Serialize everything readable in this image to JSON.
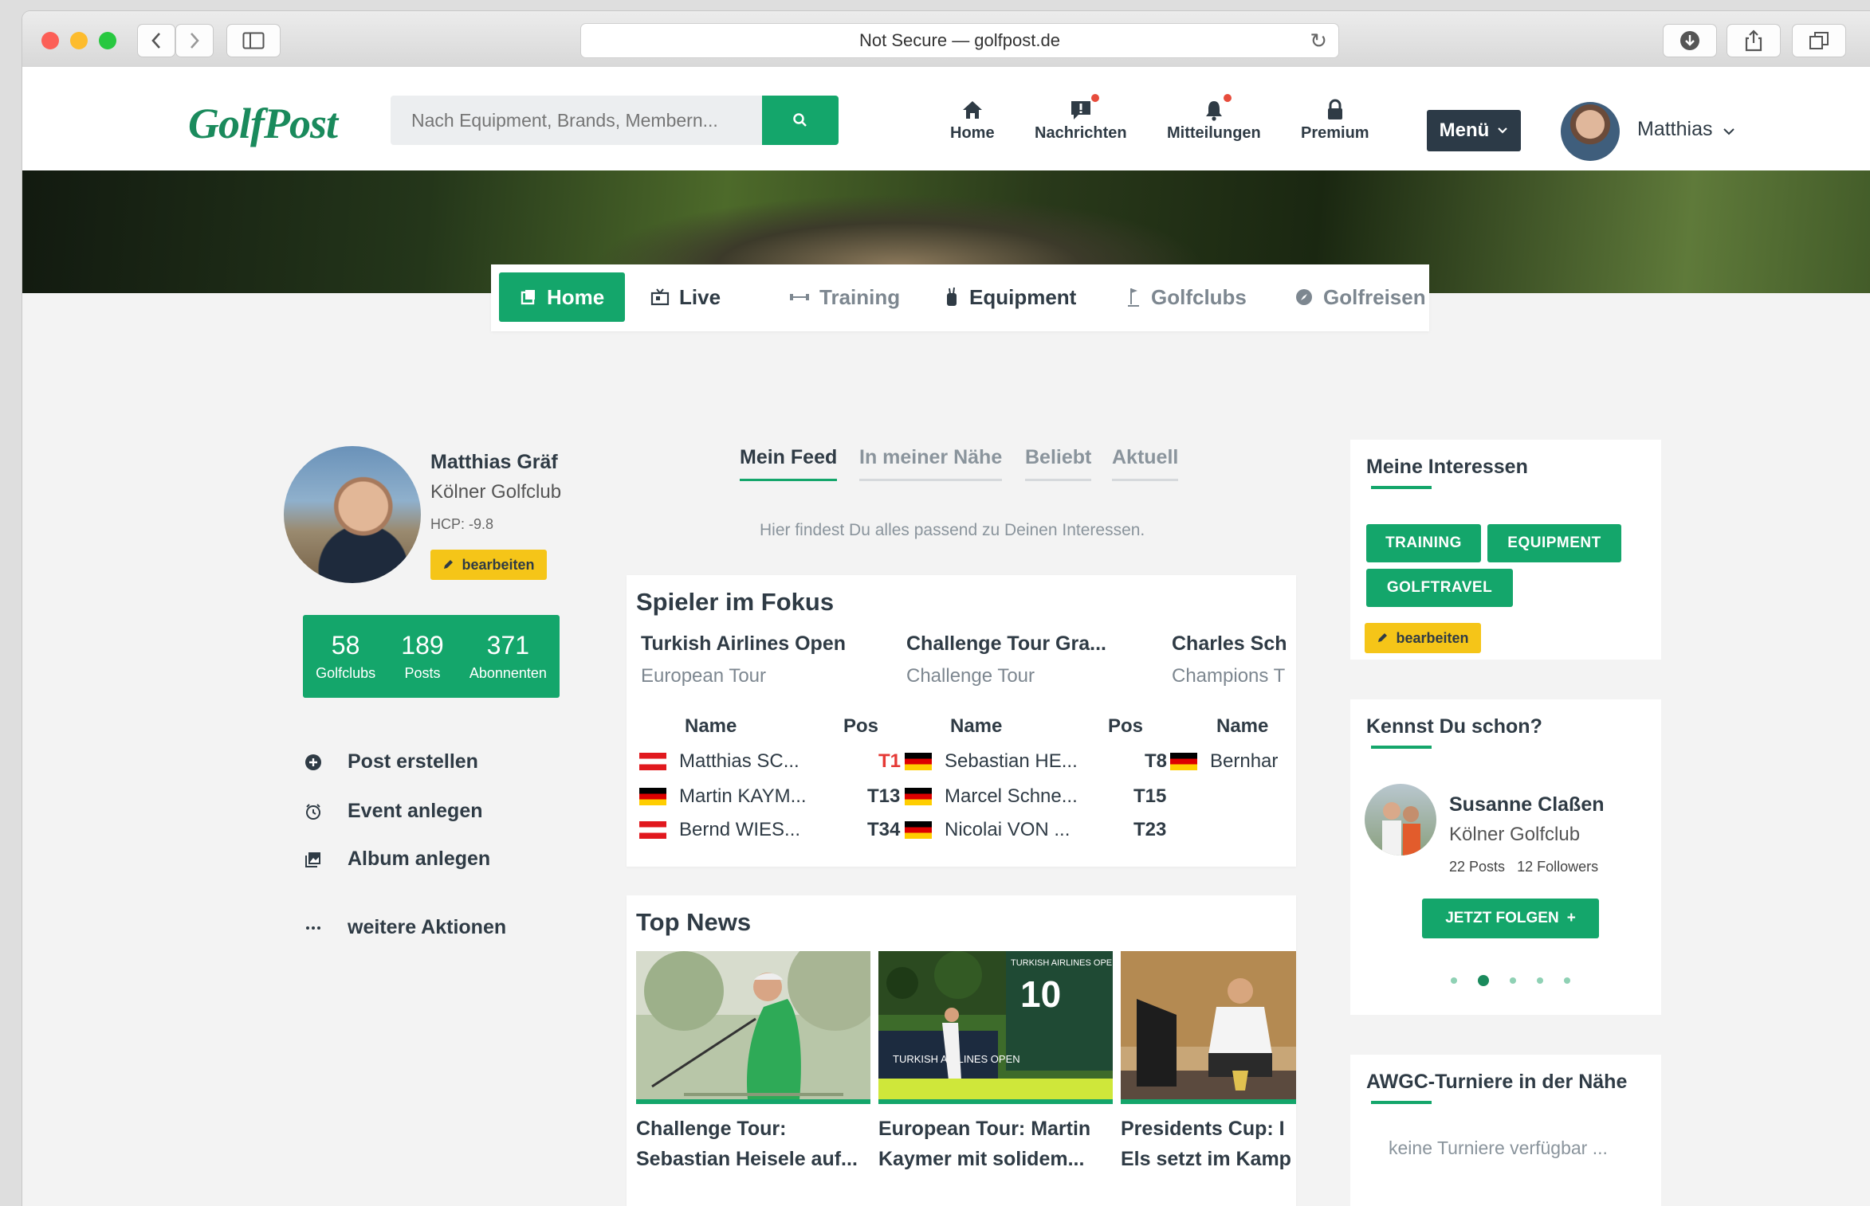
{
  "browser": {
    "address": "Not Secure — golfpost.de"
  },
  "header": {
    "logo": "GolfPost",
    "search_placeholder": "Nach Equipment, Brands, Membern...",
    "nav": [
      {
        "label": "Home",
        "icon": "home-icon"
      },
      {
        "label": "Nachrichten",
        "icon": "message-icon"
      },
      {
        "label": "Mitteilungen",
        "icon": "bell-icon"
      },
      {
        "label": "Premium",
        "icon": "lock-icon"
      }
    ],
    "menu_label": "Menü",
    "user_name": "Matthias"
  },
  "subnav": [
    "Home",
    "Live",
    "Training",
    "Equipment",
    "Golfclubs",
    "Golfreisen"
  ],
  "profile": {
    "name": "Matthias Gräf",
    "club": "Kölner Golfclub",
    "hcp": "HCP: -9.8",
    "edit_label": "bearbeiten",
    "stats": [
      {
        "value": "58",
        "label": "Golfclubs"
      },
      {
        "value": "189",
        "label": "Posts"
      },
      {
        "value": "371",
        "label": "Abonnenten"
      }
    ],
    "actions": [
      {
        "label": "Post erstellen",
        "icon": "plus-circle-icon"
      },
      {
        "label": "Event anlegen",
        "icon": "alarm-clock-icon"
      },
      {
        "label": "Album anlegen",
        "icon": "album-icon"
      },
      {
        "label": "weitere Aktionen",
        "icon": "more-icon"
      }
    ]
  },
  "feed": {
    "tabs": [
      "Mein Feed",
      "In meiner Nähe",
      "Beliebt",
      "Aktuell"
    ],
    "hint": "Hier findest Du alles passend zu Deinen Interessen."
  },
  "spieler": {
    "title": "Spieler im Fokus",
    "col_name": "Name",
    "col_pos": "Pos",
    "tournaments": [
      {
        "name": "Turkish Airlines Open",
        "tour": "European Tour",
        "players": [
          {
            "name": "Matthias SC...",
            "pos": "T1",
            "flag": "at"
          },
          {
            "name": "Martin KAYM...",
            "pos": "T13",
            "flag": "de"
          },
          {
            "name": "Bernd WIES...",
            "pos": "T34",
            "flag": "at"
          }
        ]
      },
      {
        "name": "Challenge Tour Gra...",
        "tour": "Challenge Tour",
        "players": [
          {
            "name": "Sebastian HE...",
            "pos": "T8",
            "flag": "de"
          },
          {
            "name": "Marcel Schne...",
            "pos": "T15",
            "flag": "de"
          },
          {
            "name": "Nicolai VON ...",
            "pos": "T23",
            "flag": "de"
          }
        ]
      },
      {
        "name": "Charles Sch",
        "tour": "Champions T",
        "players": [
          {
            "name": "Bernhar",
            "pos": "",
            "flag": "de"
          }
        ]
      }
    ]
  },
  "news": {
    "title": "Top News",
    "items": [
      {
        "line1": "Challenge Tour:",
        "line2": "Sebastian Heisele auf..."
      },
      {
        "line1": "European Tour: Martin",
        "line2": "Kaymer mit solidem..."
      },
      {
        "line1": "Presidents Cup: I",
        "line2": "Els setzt im Kamp"
      }
    ],
    "image_texts": {
      "sign_number": "10",
      "sign_top": "TURKISH AIRLINES OPEN",
      "banner": "TURKISH AIRLINES OPEN"
    }
  },
  "interessen": {
    "title": "Meine Interessen",
    "tags": [
      "TRAINING",
      "EQUIPMENT",
      "GOLFTRAVEL"
    ],
    "edit_label": "bearbeiten"
  },
  "kennst": {
    "title": "Kennst Du schon?",
    "name": "Susanne Claßen",
    "club": "Kölner Golfclub",
    "posts": "22 Posts",
    "followers": "12 Followers",
    "follow_label": "JETZT FOLGEN",
    "pager_active": 1,
    "pager_count": 5
  },
  "awgc": {
    "title": "AWGC-Turniere in der Nähe",
    "empty": "keine Turniere verfügbar ..."
  },
  "colors": {
    "accent": "#14a66b",
    "dark": "#2c3a47",
    "highlight": "#f5c518",
    "alert": "#e53935"
  }
}
